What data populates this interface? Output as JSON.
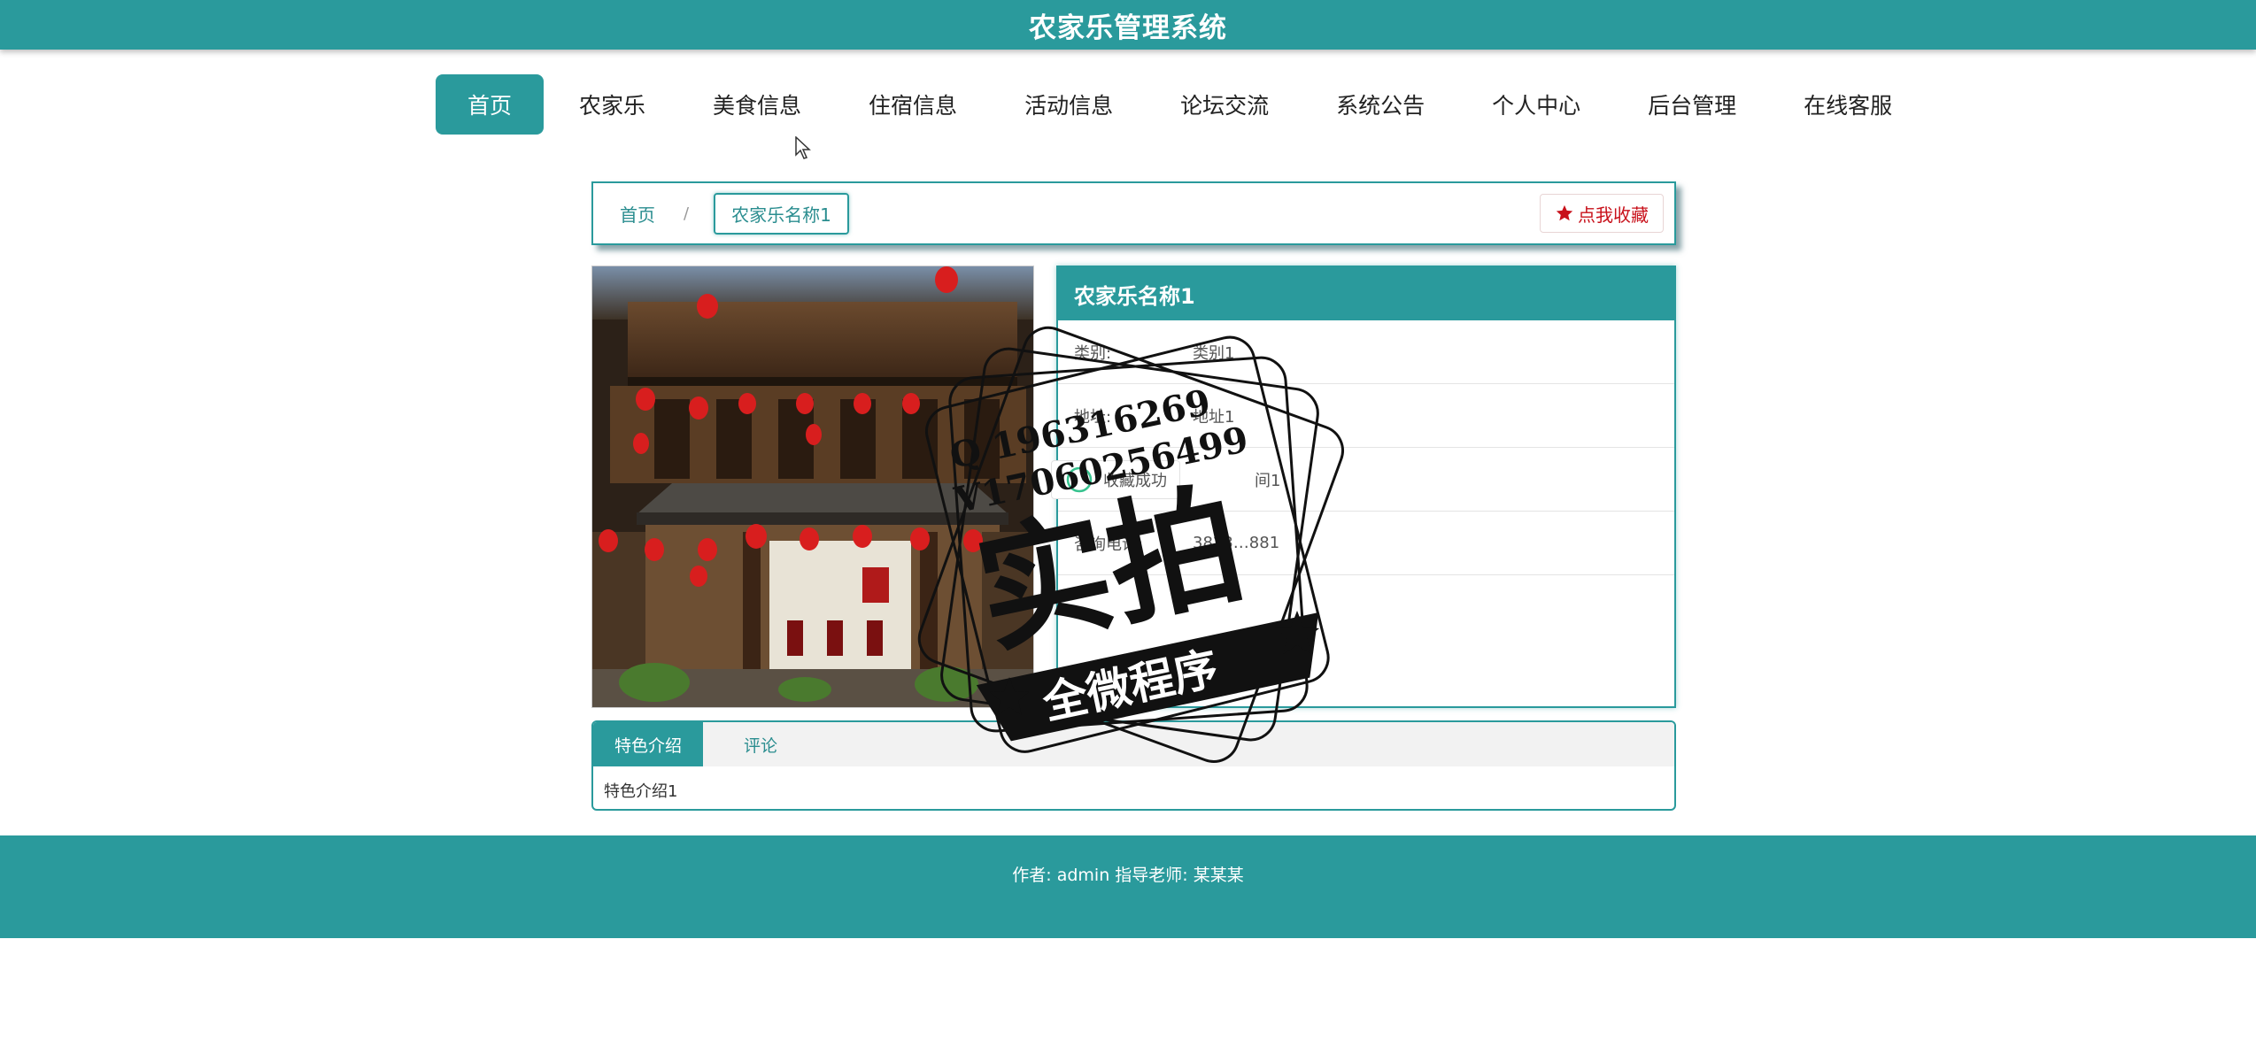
{
  "header": {
    "title": "农家乐管理系统"
  },
  "nav": {
    "items": [
      {
        "label": "首页",
        "active": true
      },
      {
        "label": "农家乐",
        "active": false
      },
      {
        "label": "美食信息",
        "active": false
      },
      {
        "label": "住宿信息",
        "active": false
      },
      {
        "label": "活动信息",
        "active": false
      },
      {
        "label": "论坛交流",
        "active": false
      },
      {
        "label": "系统公告",
        "active": false
      },
      {
        "label": "个人中心",
        "active": false
      },
      {
        "label": "后台管理",
        "active": false
      },
      {
        "label": "在线客服",
        "active": false
      }
    ]
  },
  "breadcrumb": {
    "home": "首页",
    "separator": "/",
    "current": "农家乐名称1"
  },
  "favorite_button": {
    "label": "点我收藏"
  },
  "detail": {
    "name": "农家乐名称1",
    "rows": [
      {
        "label": "类别:",
        "value": "类别1"
      },
      {
        "label": "地址:",
        "value": "地址1"
      },
      {
        "label": "",
        "value": "间1"
      },
      {
        "label": "咨询电话:",
        "value": "3823…881"
      },
      {
        "label": "",
        "value": ""
      }
    ]
  },
  "toast": {
    "text": "收藏成功"
  },
  "tabs": {
    "items": [
      {
        "label": "特色介绍",
        "active": true
      },
      {
        "label": "评论",
        "active": false
      }
    ],
    "content": "特色介绍1"
  },
  "footer": {
    "credit": "作者: admin 指导老师: 某某某"
  },
  "watermark": {
    "line1": "Q 196316269",
    "line2": "V17060256499",
    "main": "实拍",
    "banner": "全微程序"
  },
  "colors": {
    "primary": "#2a9a9c",
    "favorite": "#c8101a",
    "footer": "#2a9a9c"
  }
}
